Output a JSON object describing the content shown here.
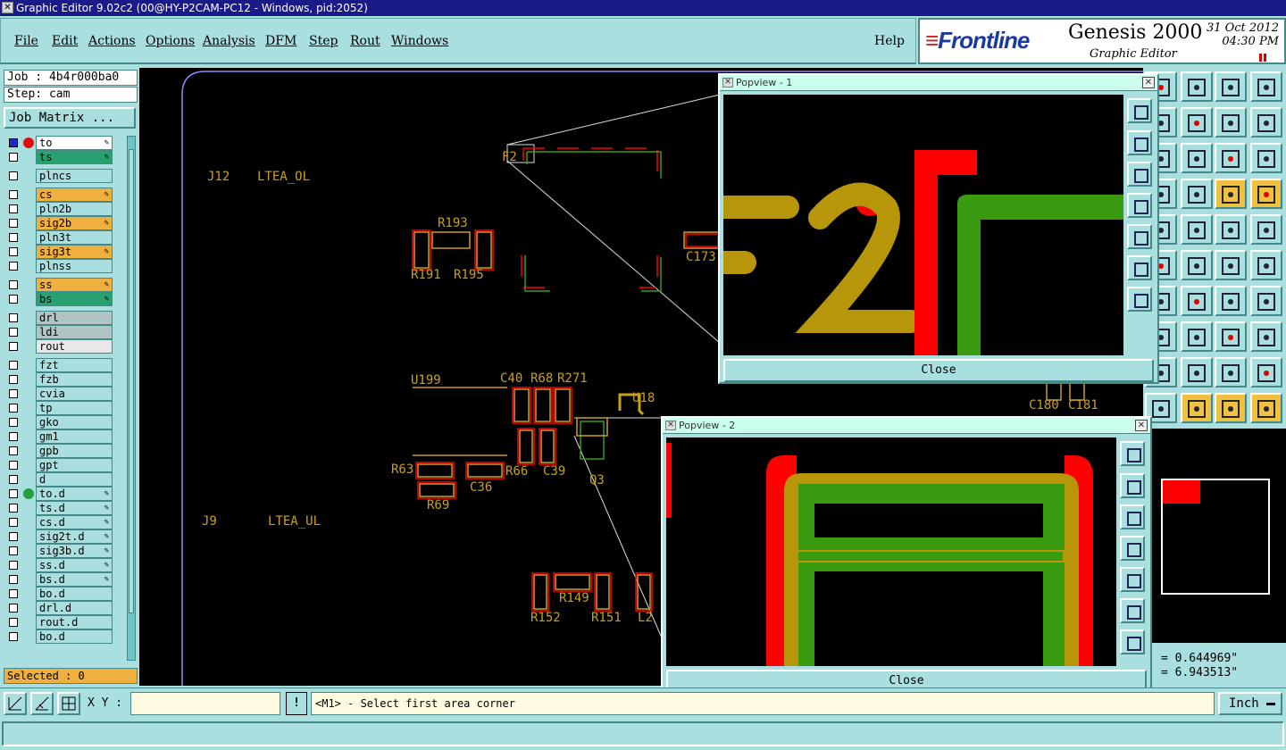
{
  "window": {
    "title": "Graphic Editor 9.02c2 (00@HY-P2CAM-PC12 - Windows, pid:2052)"
  },
  "menu": [
    "File",
    "Edit",
    "Actions",
    "Options",
    "Analysis",
    "DFM",
    "Step",
    "Rout",
    "Windows"
  ],
  "help_label": "Help",
  "brand": {
    "logo": "Frontline",
    "product": "Genesis 2000",
    "subtitle": "Graphic Editor",
    "date": "31 Oct 2012",
    "time": "04:30 PM"
  },
  "job": {
    "job_line": "Job : 4b4r000ba0",
    "step_line": "Step: cam",
    "matrix_label": "Job Matrix ..."
  },
  "layers": [
    {
      "name": "to",
      "kind": "active",
      "dot": "#e01010",
      "checked": true,
      "editable": true
    },
    {
      "name": "ts",
      "kind": "mask",
      "editable": true
    },
    {
      "name": "plncs",
      "kind": "plain"
    },
    {
      "name": "cs",
      "kind": "signal",
      "editable": true
    },
    {
      "name": "pln2b",
      "kind": "plain"
    },
    {
      "name": "sig2b",
      "kind": "signal",
      "editable": true
    },
    {
      "name": "pln3t",
      "kind": "plain"
    },
    {
      "name": "sig3t",
      "kind": "signal",
      "editable": true
    },
    {
      "name": "plnss",
      "kind": "plain"
    },
    {
      "name": "ss",
      "kind": "signal",
      "editable": true
    },
    {
      "name": "bs",
      "kind": "mask",
      "editable": true
    },
    {
      "name": "drl",
      "kind": "drill"
    },
    {
      "name": "ldi",
      "kind": "drill"
    },
    {
      "name": "rout",
      "kind": "rout"
    },
    {
      "name": "fzt",
      "kind": "plain"
    },
    {
      "name": "fzb",
      "kind": "plain"
    },
    {
      "name": "cvia",
      "kind": "plain"
    },
    {
      "name": "tp",
      "kind": "plain"
    },
    {
      "name": "gko",
      "kind": "plain"
    },
    {
      "name": "gm1",
      "kind": "plain"
    },
    {
      "name": "gpb",
      "kind": "plain"
    },
    {
      "name": "gpt",
      "kind": "plain"
    },
    {
      "name": "d",
      "kind": "plain"
    },
    {
      "name": "to.d",
      "kind": "plain",
      "dot": "#28a040",
      "editable": true
    },
    {
      "name": "ts.d",
      "kind": "plain",
      "editable": true
    },
    {
      "name": "cs.d",
      "kind": "plain",
      "editable": true
    },
    {
      "name": "sig2t.d",
      "kind": "plain",
      "editable": true
    },
    {
      "name": "sig3b.d",
      "kind": "plain",
      "editable": true
    },
    {
      "name": "ss.d",
      "kind": "plain",
      "editable": true
    },
    {
      "name": "bs.d",
      "kind": "plain",
      "editable": true
    },
    {
      "name": "bo.d",
      "kind": "plain"
    },
    {
      "name": "drl.d",
      "kind": "plain"
    },
    {
      "name": "rout.d",
      "kind": "plain"
    },
    {
      "name": "bo.d",
      "kind": "plain"
    }
  ],
  "selected_label": "Selected : 0",
  "pcb_labels": [
    "J12",
    "LTEA_OL",
    "R193",
    "R191",
    "R195",
    "C173",
    "F2",
    "U199",
    "C40",
    "R68",
    "R271",
    "U18",
    "R63",
    "R66",
    "C39",
    "C36",
    "R69",
    "Q3",
    "J9",
    "LTEA_UL",
    "R149",
    "R152",
    "R151",
    "L2",
    "C180",
    "C181"
  ],
  "popview1": {
    "title": "Popview - 1",
    "close": "Close"
  },
  "popview2": {
    "title": "Popview - 2",
    "close": "Close"
  },
  "coords": {
    "x": "= 0.644969\"",
    "y": "= 6.943513\""
  },
  "bottom": {
    "xy_label": "X Y :",
    "xy_value": "",
    "prompt": "<M1> - Select first area corner",
    "units": "Inch"
  },
  "colors": {
    "background": "#a9dfdf",
    "canvas": "#000000",
    "copper_top": "#f00000",
    "mask_green": "#3a9a10",
    "silk": "#c8a020"
  }
}
